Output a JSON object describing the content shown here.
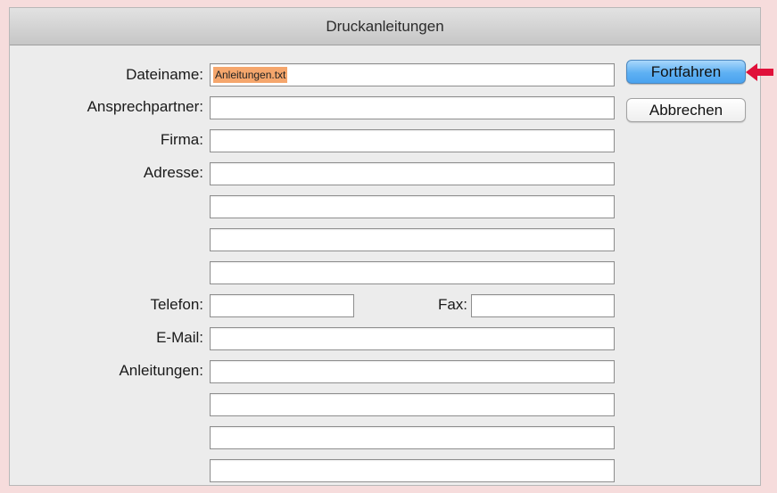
{
  "dialog": {
    "title": "Druckanleitungen"
  },
  "labels": {
    "filename": "Dateiname:",
    "contact": "Ansprechpartner:",
    "company": "Firma:",
    "address": "Adresse:",
    "phone": "Telefon:",
    "fax": "Fax:",
    "email": "E-Mail:",
    "instructions": "Anleitungen:"
  },
  "fields": {
    "filename": "Anleitungen.txt",
    "contact": "",
    "company": "",
    "address_1": "",
    "address_2": "",
    "address_3": "",
    "address_4": "",
    "phone": "",
    "fax": "",
    "email": "",
    "instructions_1": "",
    "instructions_2": "",
    "instructions_3": "",
    "instructions_4": ""
  },
  "buttons": {
    "continue": "Fortfahren",
    "cancel": "Abbrechen"
  },
  "colors": {
    "highlight": "#f5a66c",
    "primary_button": "#5eb0f3",
    "arrow": "#e0103a"
  },
  "annotation": {
    "arrow_icon": "arrow-left-icon"
  }
}
